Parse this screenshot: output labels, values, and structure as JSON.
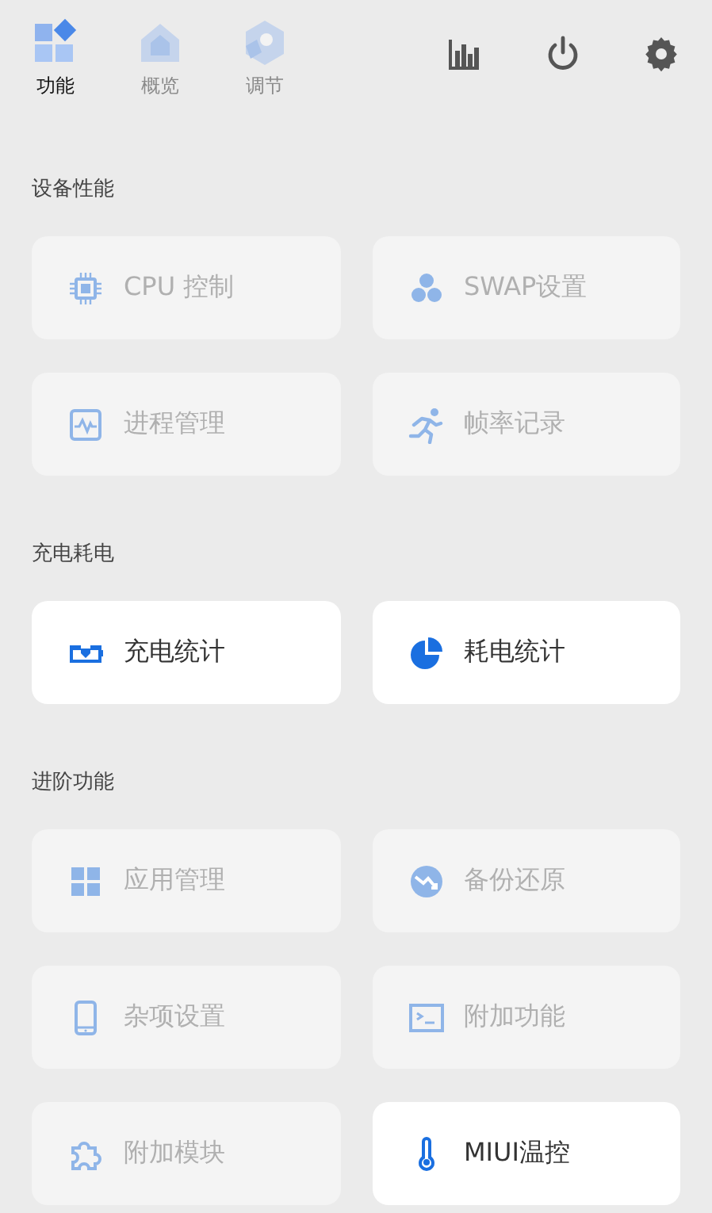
{
  "tabs": [
    {
      "label": "功能",
      "selected": true
    },
    {
      "label": "概览",
      "selected": false
    },
    {
      "label": "调节",
      "selected": false
    }
  ],
  "sections": [
    {
      "title": "设备性能",
      "items": [
        {
          "label": "CPU 控制",
          "disabled": true
        },
        {
          "label": "SWAP设置",
          "disabled": true
        },
        {
          "label": "进程管理",
          "disabled": true
        },
        {
          "label": "帧率记录",
          "disabled": true
        }
      ]
    },
    {
      "title": "充电耗电",
      "items": [
        {
          "label": "充电统计",
          "disabled": false
        },
        {
          "label": "耗电统计",
          "disabled": false
        }
      ]
    },
    {
      "title": "进阶功能",
      "items": [
        {
          "label": "应用管理",
          "disabled": true
        },
        {
          "label": "备份还原",
          "disabled": true
        },
        {
          "label": "杂项设置",
          "disabled": true
        },
        {
          "label": "附加功能",
          "disabled": true
        },
        {
          "label": "附加模块",
          "disabled": true
        },
        {
          "label": "MIUI温控",
          "disabled": false
        }
      ]
    }
  ]
}
